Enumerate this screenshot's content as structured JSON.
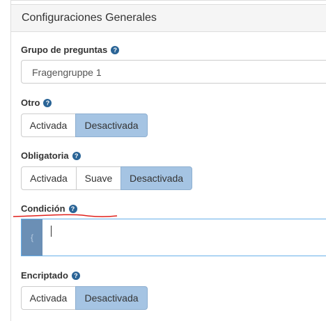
{
  "panel": {
    "title": "Configuraciones Generales"
  },
  "group": {
    "label": "Grupo de preguntas",
    "value": "Fragengruppe 1"
  },
  "otro": {
    "label": "Otro",
    "options": [
      "Activada",
      "Desactivada"
    ],
    "selected": "Desactivada"
  },
  "obligatoria": {
    "label": "Obligatoria",
    "options": [
      "Activada",
      "Suave",
      "Desactivada"
    ],
    "selected": "Desactivada"
  },
  "condicion": {
    "label": "Condición",
    "addon": "{",
    "value": ""
  },
  "encriptado": {
    "label": "Encriptado",
    "options": [
      "Activada",
      "Desactivada"
    ],
    "selected": "Desactivada"
  },
  "help_icon": "?",
  "colors": {
    "active": "#a5c4e3",
    "help": "#2a6496",
    "annotation": "#e0201b"
  }
}
